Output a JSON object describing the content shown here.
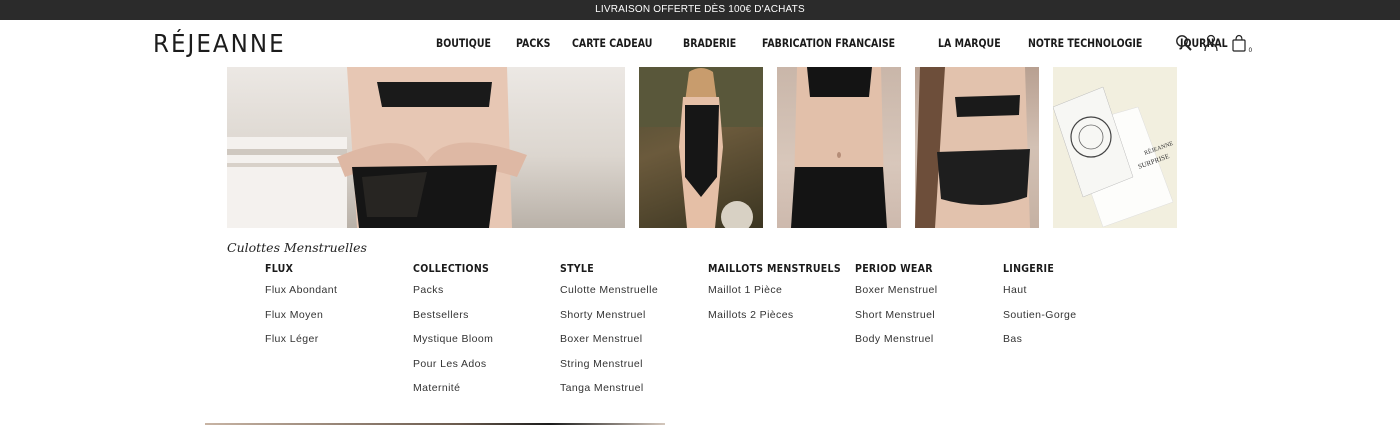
{
  "announcement": "LIVRAISON OFFERTE DÈS 100€ D'ACHATS",
  "header": {
    "logo": "RÉJEANNE",
    "nav": [
      "BOUTIQUE",
      "PACKS",
      "CARTE CADEAU",
      "BRADERIE",
      "FABRICATION FRANCAISE",
      "LA MARQUE",
      "NOTRE TECHNOLOGIE",
      "JOURNAL"
    ],
    "icons": [
      "search-icon",
      "account-icon",
      "cart-icon"
    ],
    "cart_count": "0"
  },
  "gallery": {
    "images": [
      "hands-heart-lingerie",
      "black-swimsuit",
      "black-boxer-brief",
      "lace-brief-back",
      "gift-card"
    ],
    "gift_card_brand": "RÉJEANNE",
    "gift_card_text": "SURPRISE"
  },
  "mega_menu": {
    "title": "Culottes Menstruelles",
    "columns": [
      {
        "heading": "FLUX",
        "items": [
          "Flux Abondant",
          "Flux Moyen",
          "Flux Léger"
        ]
      },
      {
        "heading": "COLLECTIONS",
        "items": [
          "Packs",
          "Bestsellers",
          "Mystique Bloom",
          "Pour Les Ados",
          "Maternité"
        ]
      },
      {
        "heading": "STYLE",
        "items": [
          "Culotte Menstruelle",
          "Shorty Menstruel",
          "Boxer Menstruel",
          "String Menstruel",
          "Tanga Menstruel"
        ]
      },
      {
        "heading": "MAILLOTS MENSTRUELS",
        "items": [
          "Maillot 1 Pièce",
          "Maillots 2 Pièces"
        ]
      },
      {
        "heading": "PERIOD WEAR",
        "items": [
          "Boxer Menstruel",
          "Short Menstruel",
          "Body Menstruel"
        ]
      },
      {
        "heading": "LINGERIE",
        "items": [
          "Haut",
          "Soutien-Gorge",
          "Bas"
        ]
      }
    ]
  }
}
